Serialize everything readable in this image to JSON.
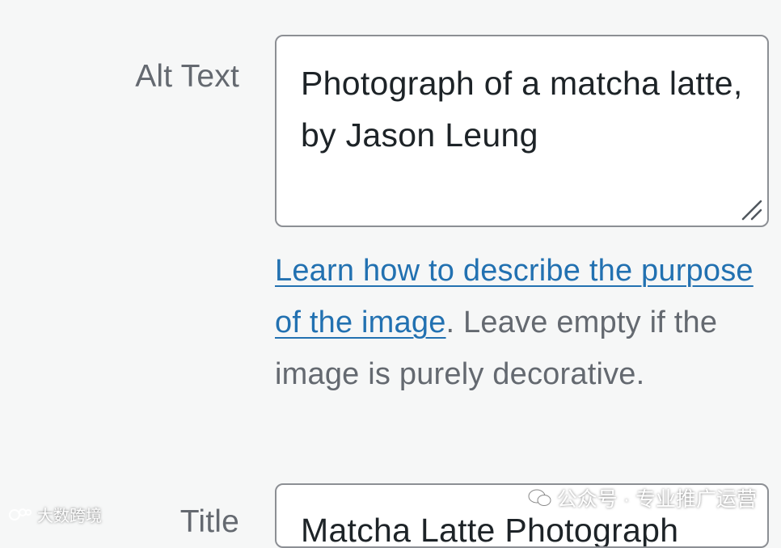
{
  "alt_text": {
    "label": "Alt Text",
    "value": "Photograph of a matcha latte, by Jason Leung"
  },
  "help": {
    "link_text": "Learn how to describe the purpose of the image",
    "rest_text": ". Leave empty if the image is purely decorative."
  },
  "title": {
    "label": "Title",
    "value": "Matcha Latte Photograph"
  },
  "watermarks": {
    "right": "公众号 · 专业推广运营",
    "left": "大数跨境"
  }
}
